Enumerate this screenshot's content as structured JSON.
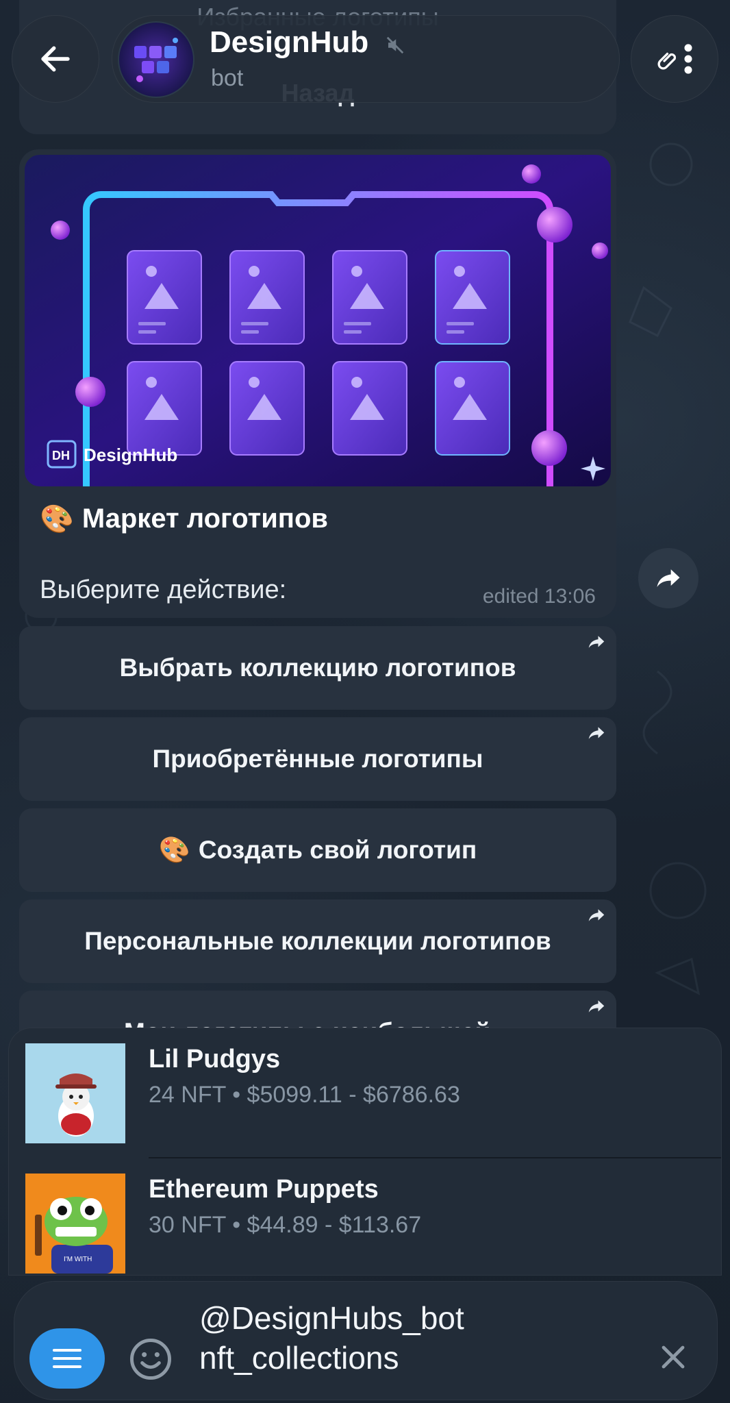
{
  "header": {
    "title": "DesignHub",
    "subtitle": "bot"
  },
  "previous_message": {
    "top_text": "Избранные логотипы",
    "back_label": "Назад"
  },
  "message": {
    "banner_brand_short": "DH",
    "banner_brand": "DesignHub",
    "title": "Маркет логотипов",
    "title_emoji": "🎨",
    "body": "Выберите действие:",
    "time": "edited 13:06"
  },
  "keyboard": [
    {
      "label": "Выбрать коллекцию логотипов",
      "emoji": "",
      "has_arrow": true
    },
    {
      "label": "Приобретённые логотипы",
      "emoji": "",
      "has_arrow": true
    },
    {
      "label": "Создать свой логотип",
      "emoji": "🎨",
      "has_arrow": false
    },
    {
      "label": "Персональные коллекции логотипов",
      "emoji": "",
      "has_arrow": true
    },
    {
      "label": "Мои логотипы с наибольшей...",
      "emoji": "",
      "has_arrow": true
    }
  ],
  "results": [
    {
      "title": "Lil Pudgys",
      "subtitle": "24 NFT • $5099.11 - $6786.63",
      "thumb_bg": "#a9d8ec"
    },
    {
      "title": "Ethereum Puppets",
      "subtitle": "30 NFT • $44.89 - $113.67",
      "thumb_bg": "#f08a1c"
    }
  ],
  "composer": {
    "line1": "@DesignHubs_bot",
    "line2": "nft_collections"
  },
  "colors": {
    "accent": "#2f94e8",
    "bubble": "#252f3c",
    "background": "#1b2532"
  },
  "icons": [
    "back-arrow-icon",
    "mute-icon",
    "attach-icon",
    "more-vertical-icon",
    "forward-icon",
    "menu-icon",
    "emoji-icon",
    "close-icon"
  ]
}
